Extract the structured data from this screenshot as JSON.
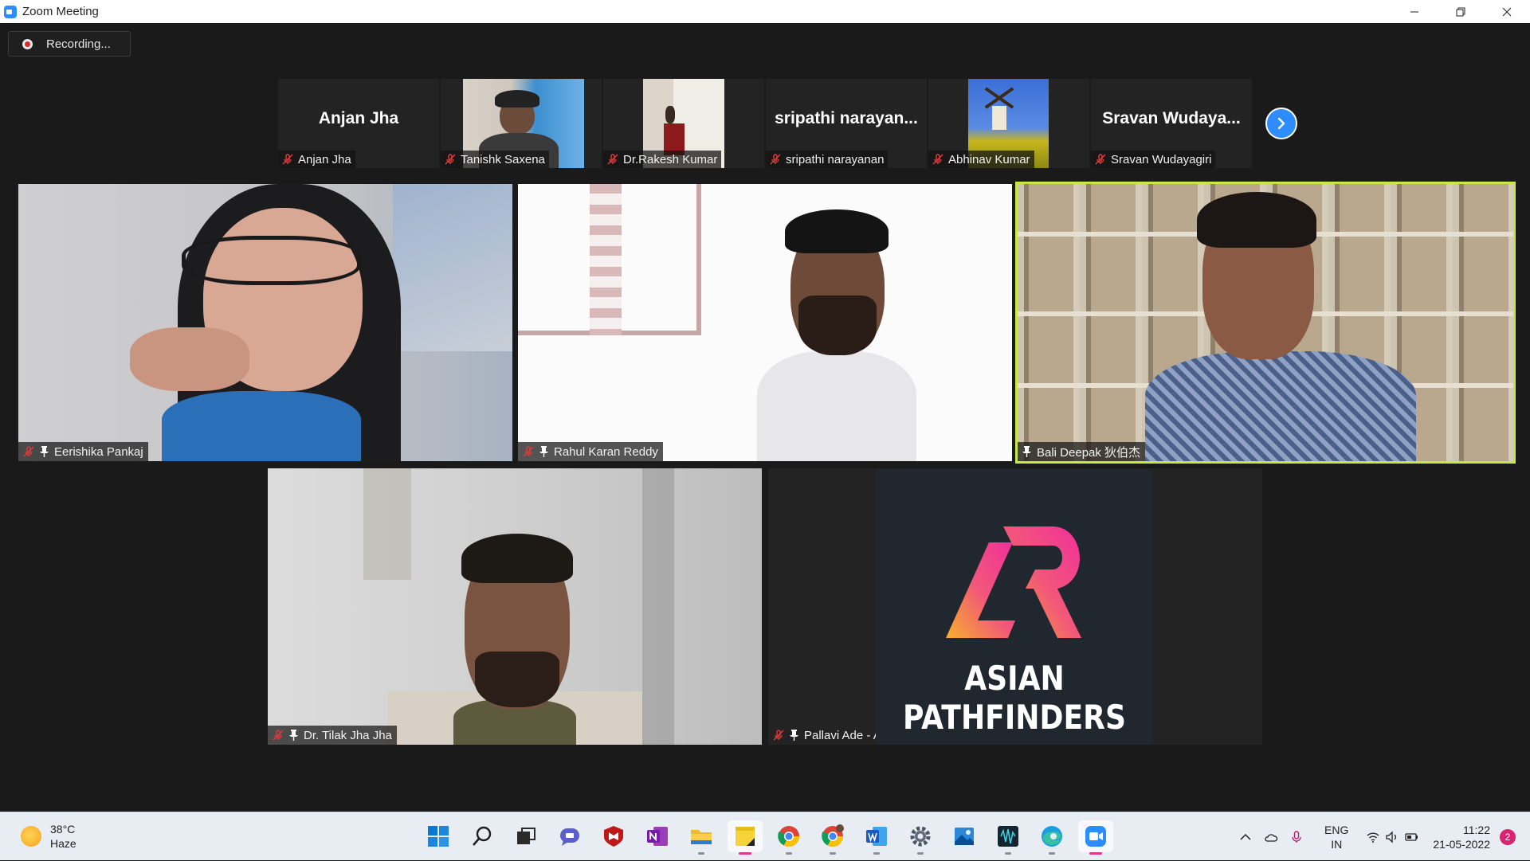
{
  "window": {
    "title": "Zoom Meeting"
  },
  "recording": {
    "label": "Recording..."
  },
  "strip": [
    {
      "display_name": "Anjan Jha",
      "tag": "Anjan Jha",
      "video": false
    },
    {
      "display_name": "",
      "tag": "Tanishk Saxena",
      "video": true
    },
    {
      "display_name": "",
      "tag": "Dr.Rakesh Kumar",
      "video": true
    },
    {
      "display_name": "sripathi  narayan...",
      "tag": "sripathi narayanan",
      "video": false
    },
    {
      "display_name": "",
      "tag": "Abhinav Kumar",
      "video": true
    },
    {
      "display_name": "Sravan  Wudaya...",
      "tag": "Sravan Wudayagiri",
      "video": false
    }
  ],
  "tiles": [
    {
      "name": "Eerishika Pankaj",
      "muted": true,
      "pinned": true
    },
    {
      "name": "Rahul Karan Reddy",
      "muted": true,
      "pinned": true
    },
    {
      "name": "Bali Deepak 狄伯杰",
      "muted": false,
      "pinned": true,
      "active_speaker": true
    },
    {
      "name": "Dr. Tilak Jha Jha",
      "muted": true,
      "pinned": true
    },
    {
      "name": "Pallavi Ade - Asian Pathfinders",
      "muted": true,
      "pinned": true
    }
  ],
  "logo": {
    "text": "ASIAN PATHFINDERS"
  },
  "taskbar": {
    "weather": {
      "temp": "38°C",
      "condition": "Haze"
    },
    "lang": {
      "line1": "ENG",
      "line2": "IN"
    },
    "clock": {
      "time": "11:22",
      "date": "21-05-2022"
    },
    "notifications": "2"
  },
  "colors": {
    "accent": "#2d8cff",
    "active_speaker": "#c8e84a",
    "mute_red": "#e03a3a",
    "background": "#1a1a1a"
  }
}
